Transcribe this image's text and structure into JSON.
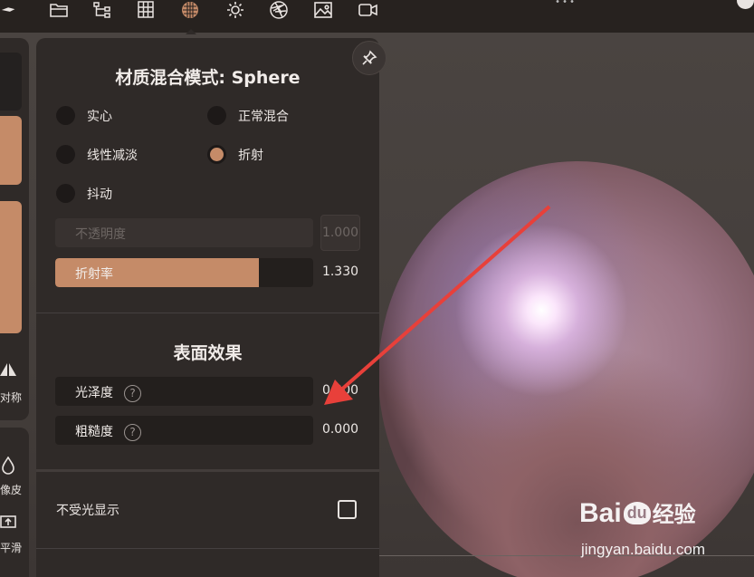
{
  "toolbar": {
    "icons": [
      "hand-icon",
      "folder-icon",
      "hierarchy-icon",
      "grid-icon",
      "material-icon",
      "light-icon",
      "aperture-icon",
      "image-icon",
      "camera-icon"
    ],
    "active": "material-icon",
    "accent": "#c58b68"
  },
  "left": {
    "symmetry_label": "对称",
    "eraser_label": "像皮",
    "smooth_label": "平滑"
  },
  "panel": {
    "title": "材质混合模式: Sphere",
    "modes": [
      {
        "label": "实心",
        "checked": false
      },
      {
        "label": "正常混合",
        "checked": false
      },
      {
        "label": "线性减淡",
        "checked": false
      },
      {
        "label": "折射",
        "checked": true
      },
      {
        "label": "抖动",
        "checked": false
      }
    ],
    "opacity": {
      "label": "不透明度",
      "value": "1.000",
      "disabled": true
    },
    "refraction": {
      "label": "折射率",
      "value": "1.330",
      "fill_fraction": 0.79
    },
    "surface_title": "表面效果",
    "gloss": {
      "label": "光泽度",
      "value": "0.000",
      "help": "?"
    },
    "roughness": {
      "label": "粗糙度",
      "value": "0.000",
      "help": "?"
    },
    "unlit": {
      "label": "不受光显示",
      "checked": false
    }
  },
  "watermark": {
    "brand": "Bai",
    "brand_du": "du",
    "brand_cn": "经验",
    "url": "jingyan.baidu.com"
  },
  "colors": {
    "panel_bg": "#2f2a28",
    "annotation_arrow": "#e8403a"
  }
}
